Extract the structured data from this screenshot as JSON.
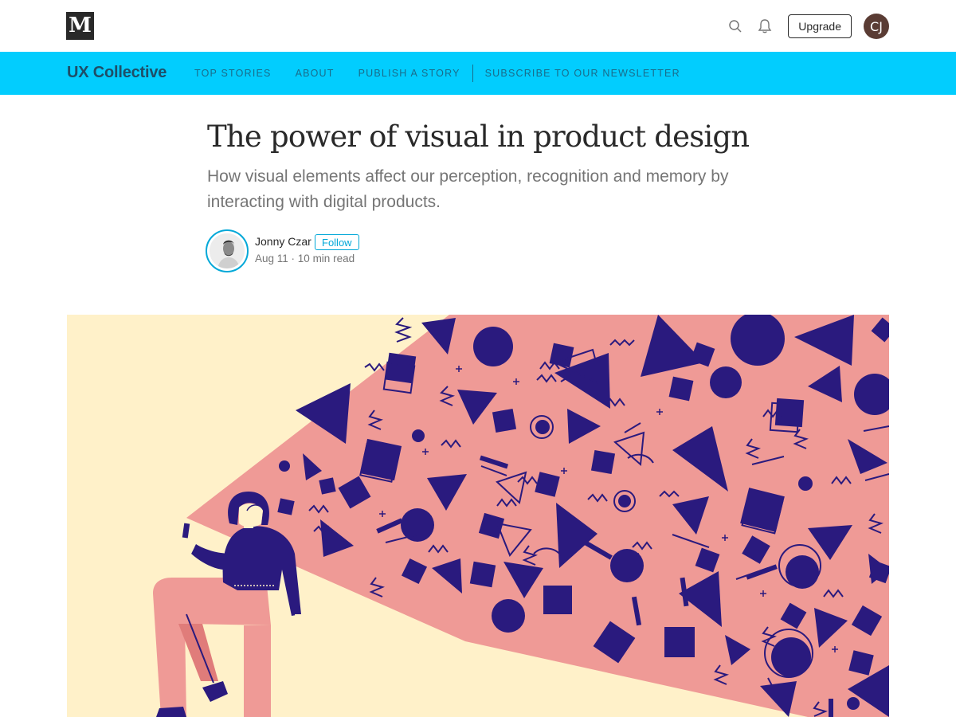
{
  "topbar": {
    "logo_letter": "M",
    "upgrade_label": "Upgrade",
    "user_initials": "CJ",
    "icons": [
      "search-icon",
      "bell-icon"
    ]
  },
  "publication": {
    "name": "UX Collective",
    "nav": [
      {
        "label": "TOP STORIES"
      },
      {
        "label": "ABOUT"
      },
      {
        "label": "PUBLISH A STORY"
      },
      {
        "label": "SUBSCRIBE TO OUR NEWSLETTER"
      }
    ],
    "bar_color": "#02cdfe"
  },
  "article": {
    "title": "The power of visual in product design",
    "subtitle": "How visual elements affect our perception, recognition and memory by interacting with digital products.",
    "author": "Jonny Czar",
    "follow_label": "Follow",
    "date": "Aug 11",
    "read_time": "10 min read"
  },
  "hero": {
    "background": "#fff1c9",
    "beam_color": "#ef9a96",
    "shape_color": "#2a1a7e"
  }
}
